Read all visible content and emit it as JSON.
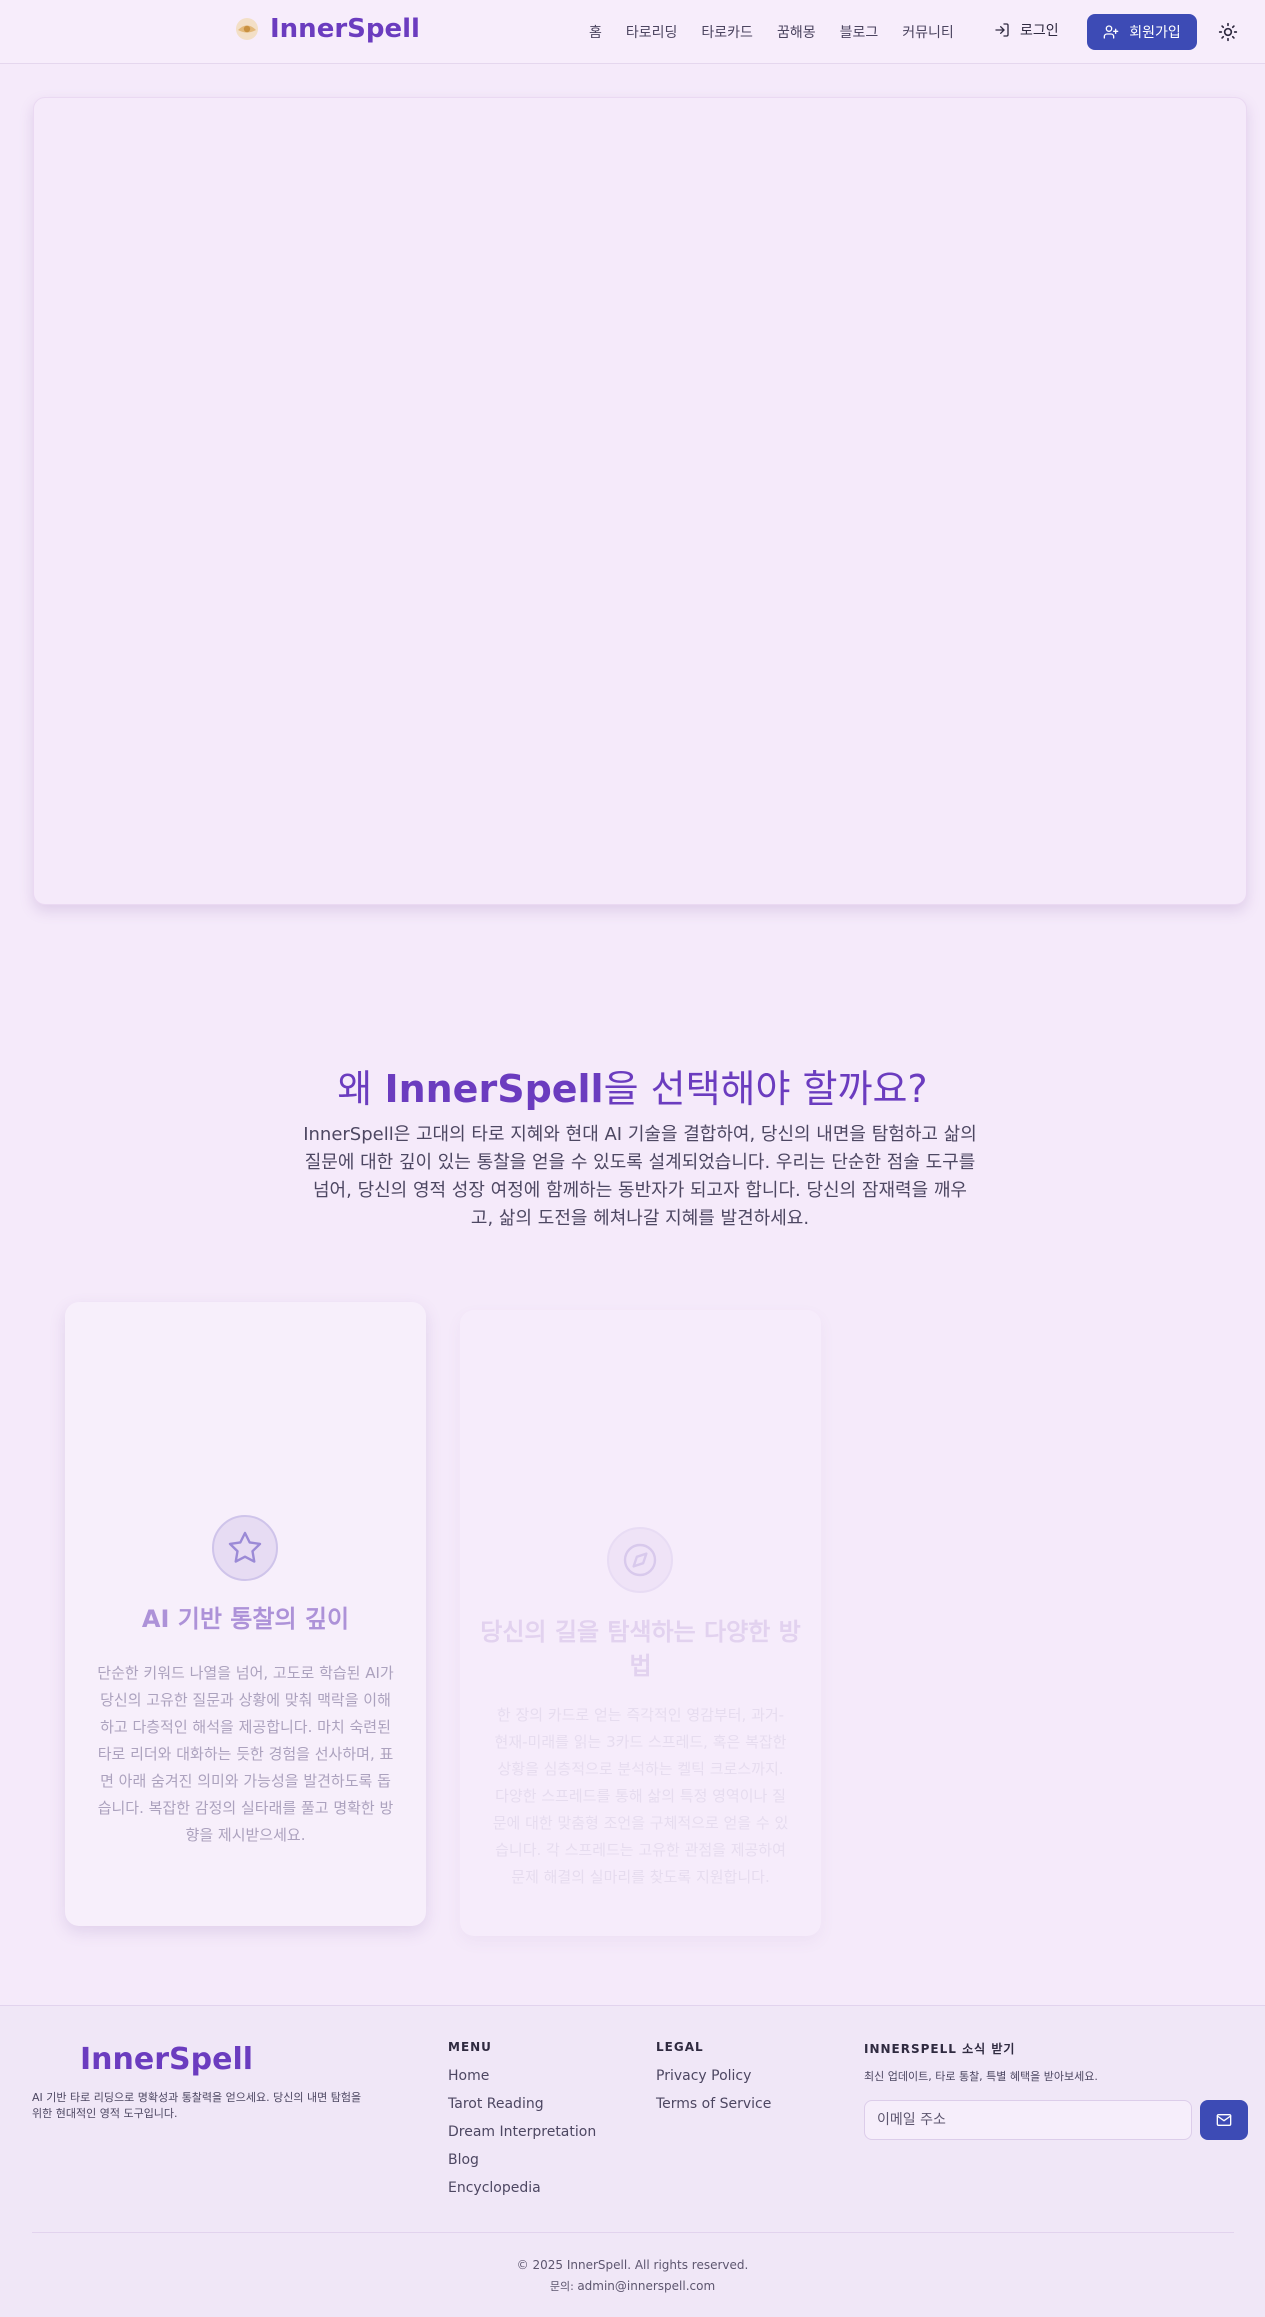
{
  "header": {
    "brand": "InnerSpell",
    "nav": [
      "홈",
      "타로리딩",
      "타로카드",
      "꿈해몽",
      "블로그",
      "커뮤니티"
    ],
    "login_label": "로그인",
    "signup_label": "회원가입"
  },
  "why": {
    "title_prefix": "왜 ",
    "title_brand": "InnerSpell",
    "title_suffix": "을 선택해야 할까요?",
    "description": "InnerSpell은 고대의 타로 지혜와 현대 AI 기술을 결합하여, 당신의 내면을 탐험하고 삶의 질문에 대한 깊이 있는 통찰을 얻을 수 있도록 설계되었습니다. 우리는 단순한 점술 도구를 넘어, 당신의 영적 성장 여정에 함께하는 동반자가 되고자 합니다. 당신의 잠재력을 깨우고, 삶의 도전을 헤쳐나갈 지혜를 발견하세요."
  },
  "features": [
    {
      "icon": "star-icon",
      "title": "AI 기반 통찰의 깊이",
      "text": "단순한 키워드 나열을 넘어, 고도로 학습된 AI가 당신의 고유한 질문과 상황에 맞춰 맥락을 이해하고 다층적인 해석을 제공합니다. 마치 숙련된 타로 리더와 대화하는 듯한 경험을 선사하며, 표면 아래 숨겨진 의미와 가능성을 발견하도록 돕습니다. 복잡한 감정의 실타래를 풀고 명확한 방향을 제시받으세요."
    },
    {
      "icon": "compass-icon",
      "title": "당신의 길을 탐색하는 다양한 방법",
      "text": "한 장의 카드로 얻는 즉각적인 영감부터, 과거-현재-미래를 읽는 3카드 스프레드, 혹은 복잡한 상황을 심층적으로 분석하는 켈틱 크로스까지. 다양한 스프레드를 통해 삶의 특정 영역이나 질문에 대한 맞춤형 조언을 구체적으로 얻을 수 있습니다. 각 스프레드는 고유한 관점을 제공하여 문제 해결의 실마리를 찾도록 지원합니다."
    }
  ],
  "footer": {
    "brand": "InnerSpell",
    "tagline": "AI 기반 타로 리딩으로 명확성과 통찰력을 얻으세요. 당신의 내면 탐험을 위한 현대적인 영적 도구입니다.",
    "menu_title": "MENU",
    "menu": [
      "Home",
      "Tarot Reading",
      "Dream Interpretation",
      "Blog",
      "Encyclopedia"
    ],
    "legal_title": "LEGAL",
    "legal": [
      "Privacy Policy",
      "Terms of Service"
    ],
    "newsletter_title": "INNERSPELL 소식 받기",
    "newsletter_desc": "최신 업데이트, 타로 통찰, 특별 혜택을 받아보세요.",
    "email_placeholder": "이메일 주소",
    "copyright": "© 2025 InnerSpell. All rights reserved.",
    "contact_label": "문의: ",
    "contact_email": "admin@innerspell.com"
  }
}
